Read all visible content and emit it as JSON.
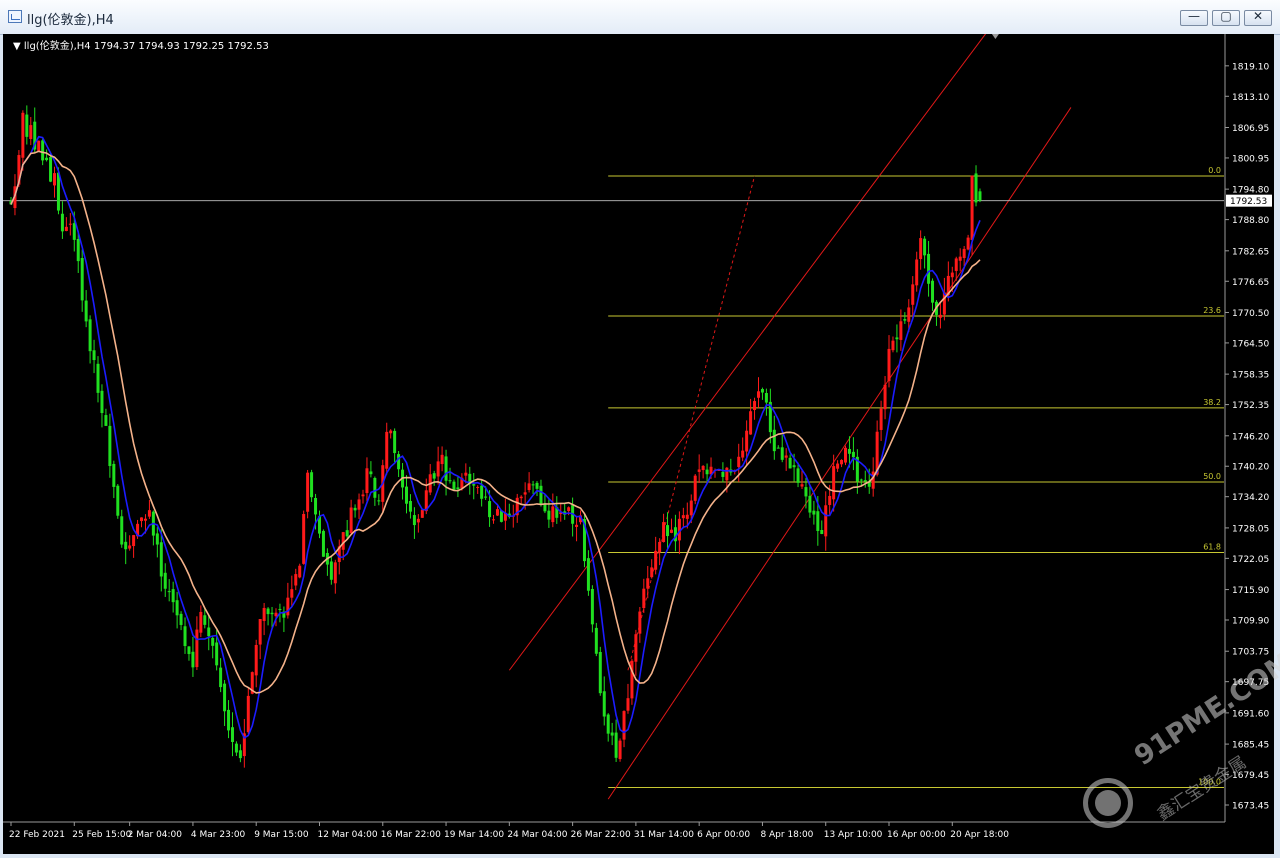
{
  "window": {
    "title": "llg(伦敦金),H4",
    "min_label": "—",
    "max_label": "▢",
    "close_label": "✕"
  },
  "chart_header": {
    "symbol": "llg(伦敦金),H4",
    "ohlc": "1794.37 1794.93 1792.25 1792.53"
  },
  "watermark": {
    "text": "91PME.COM",
    "sub": "鑫汇宝贵金属"
  },
  "colors": {
    "background": "#000000",
    "bull": "#ff1a1a",
    "bear": "#20e020",
    "ma_fast": "#1c1cff",
    "ma_slow": "#f4b28a",
    "fib": "#c8c832",
    "channel": "#e01818",
    "current_price_line": "#c0c0c0"
  },
  "chart_data": {
    "type": "candlestick",
    "timeframe": "H4",
    "ylim": [
      1670.0,
      1822.2
    ],
    "y_ticks": [
      1819.1,
      1813.1,
      1806.95,
      1800.95,
      1794.8,
      1788.8,
      1782.65,
      1776.65,
      1770.5,
      1764.5,
      1758.35,
      1752.35,
      1746.2,
      1740.2,
      1734.2,
      1728.05,
      1722.05,
      1715.9,
      1709.9,
      1703.75,
      1697.75,
      1691.6,
      1685.45,
      1679.45,
      1673.45
    ],
    "x_labels": [
      {
        "label": "22 Feb 2021",
        "index": 0
      },
      {
        "label": "25 Feb 15:00",
        "index": 16
      },
      {
        "label": "2 Mar 04:00",
        "index": 30
      },
      {
        "label": "4 Mar 23:00",
        "index": 46
      },
      {
        "label": "9 Mar 15:00",
        "index": 62
      },
      {
        "label": "12 Mar 04:00",
        "index": 78
      },
      {
        "label": "16 Mar 22:00",
        "index": 94
      },
      {
        "label": "19 Mar 14:00",
        "index": 110
      },
      {
        "label": "24 Mar 04:00",
        "index": 126
      },
      {
        "label": "26 Mar 22:00",
        "index": 142
      },
      {
        "label": "31 Mar 14:00",
        "index": 158
      },
      {
        "label": "6 Apr 00:00",
        "index": 174
      },
      {
        "label": "8 Apr 18:00",
        "index": 190
      },
      {
        "label": "13 Apr 10:00",
        "index": 206
      },
      {
        "label": "16 Apr 00:00",
        "index": 222
      },
      {
        "label": "20 Apr 18:00",
        "index": 238
      }
    ],
    "close_anchors": [
      [
        0,
        1790
      ],
      [
        3,
        1808
      ],
      [
        7,
        1803
      ],
      [
        11,
        1796
      ],
      [
        13,
        1788
      ],
      [
        16,
        1785
      ],
      [
        19,
        1768
      ],
      [
        23,
        1752
      ],
      [
        26,
        1735
      ],
      [
        29,
        1722
      ],
      [
        32,
        1730
      ],
      [
        35,
        1731
      ],
      [
        38,
        1720
      ],
      [
        41,
        1713
      ],
      [
        44,
        1705
      ],
      [
        46,
        1700
      ],
      [
        48,
        1713
      ],
      [
        51,
        1705
      ],
      [
        55,
        1690
      ],
      [
        58,
        1681
      ],
      [
        61,
        1700
      ],
      [
        64,
        1714
      ],
      [
        67,
        1710
      ],
      [
        70,
        1713
      ],
      [
        73,
        1722
      ],
      [
        75,
        1738
      ],
      [
        78,
        1726
      ],
      [
        81,
        1716
      ],
      [
        84,
        1726
      ],
      [
        87,
        1733
      ],
      [
        90,
        1738
      ],
      [
        93,
        1734
      ],
      [
        95,
        1748
      ],
      [
        97,
        1744
      ],
      [
        100,
        1734
      ],
      [
        103,
        1728
      ],
      [
        106,
        1738
      ],
      [
        109,
        1742
      ],
      [
        112,
        1734
      ],
      [
        115,
        1740
      ],
      [
        118,
        1736
      ],
      [
        121,
        1732
      ],
      [
        124,
        1730
      ],
      [
        127,
        1730
      ],
      [
        130,
        1737
      ],
      [
        133,
        1734
      ],
      [
        136,
        1729
      ],
      [
        139,
        1733
      ],
      [
        142,
        1729
      ],
      [
        144,
        1730
      ],
      [
        146,
        1716
      ],
      [
        148,
        1704
      ],
      [
        150,
        1690
      ],
      [
        153,
        1684
      ],
      [
        156,
        1696
      ],
      [
        159,
        1712
      ],
      [
        162,
        1722
      ],
      [
        165,
        1728
      ],
      [
        168,
        1726
      ],
      [
        171,
        1732
      ],
      [
        174,
        1740
      ],
      [
        177,
        1740
      ],
      [
        180,
        1737
      ],
      [
        183,
        1740
      ],
      [
        185,
        1745
      ],
      [
        187,
        1750
      ],
      [
        189,
        1755
      ],
      [
        191,
        1752
      ],
      [
        193,
        1744
      ],
      [
        196,
        1742
      ],
      [
        199,
        1738
      ],
      [
        202,
        1732
      ],
      [
        205,
        1728
      ],
      [
        208,
        1740
      ],
      [
        211,
        1745
      ],
      [
        214,
        1738
      ],
      [
        217,
        1736
      ],
      [
        220,
        1750
      ],
      [
        222,
        1762
      ],
      [
        224,
        1767
      ],
      [
        226,
        1768
      ],
      [
        228,
        1778
      ],
      [
        230,
        1785
      ],
      [
        232,
        1776
      ],
      [
        234,
        1770
      ],
      [
        236,
        1774
      ],
      [
        238,
        1778
      ],
      [
        240,
        1782
      ],
      [
        242,
        1787
      ],
      [
        243,
        1796
      ],
      [
        244,
        1794
      ],
      [
        245,
        1792.53
      ]
    ],
    "last_ohlc": {
      "open": 1794.37,
      "high": 1794.93,
      "low": 1792.25,
      "close": 1792.53
    },
    "current_price": 1792.53,
    "fibonacci": {
      "levels": [
        {
          "label": "0.0",
          "price": 1797.4
        },
        {
          "label": "23.6",
          "price": 1769.8
        },
        {
          "label": "38.2",
          "price": 1751.7
        },
        {
          "label": "50.0",
          "price": 1737.1
        },
        {
          "label": "61.8",
          "price": 1723.2
        },
        {
          "label": "100.0",
          "price": 1676.9
        }
      ],
      "start_index": 151
    },
    "channel": {
      "lower": {
        "from": [
          151,
          1674.6
        ],
        "to": [
          268,
          1810.9
        ]
      },
      "upper": {
        "from": [
          126,
          1700.0
        ],
        "to": [
          247,
          1826.0
        ]
      }
    },
    "dashed_trend": {
      "from": [
        156,
        1700.0
      ],
      "to": [
        188,
        1797.4
      ]
    },
    "moving_averages": [
      {
        "period": 6,
        "color": "#1c1cff"
      },
      {
        "period": 14,
        "color": "#f4b28a"
      }
    ]
  }
}
